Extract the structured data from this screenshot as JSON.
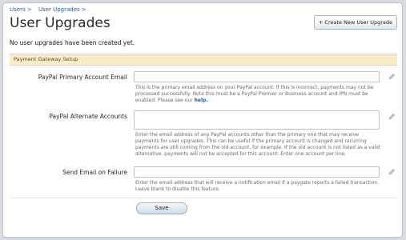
{
  "breadcrumb": [
    "Users >",
    "User Upgrades >"
  ],
  "page_title": "User Upgrades",
  "create_button": "+ Create New User Upgrade",
  "empty_message": "No user upgrades have been created yet.",
  "section_title": "Payment Gateway Setup",
  "fields": {
    "primary_email": {
      "label": "PayPal Primary Account Email",
      "value": "",
      "help": "This is the primary email address on your PayPal account. If this is incorrect, payments may not be processed successfully. Note this must be a PayPal Premier or Business account and IPN must be enabled. Please see our",
      "help_link": "help."
    },
    "alternate_accounts": {
      "label": "PayPal Alternate Accounts",
      "value": "",
      "help": "Enter the email address of any PayPal accounts other than the primary one that may receive payments for user upgrades. This can be useful if the primary account is changed and recurring payments are still coming from the old account, for example. If the old account is not listed as a valid alternative, payments will not be accepted for this account. Enter one account per line."
    },
    "failure_email": {
      "label": "Send Email on Failure",
      "value": "",
      "help": "Enter the email address that will receive a notification email if a paygate reports a failed transaction. Leave blank to disable this feature."
    }
  },
  "save_button": "Save",
  "icons": {
    "edit": "pencil-icon"
  },
  "colors": {
    "section_bg": "#fcebc8",
    "link": "#2b5d8c",
    "page_bg": "#d7dde2"
  }
}
